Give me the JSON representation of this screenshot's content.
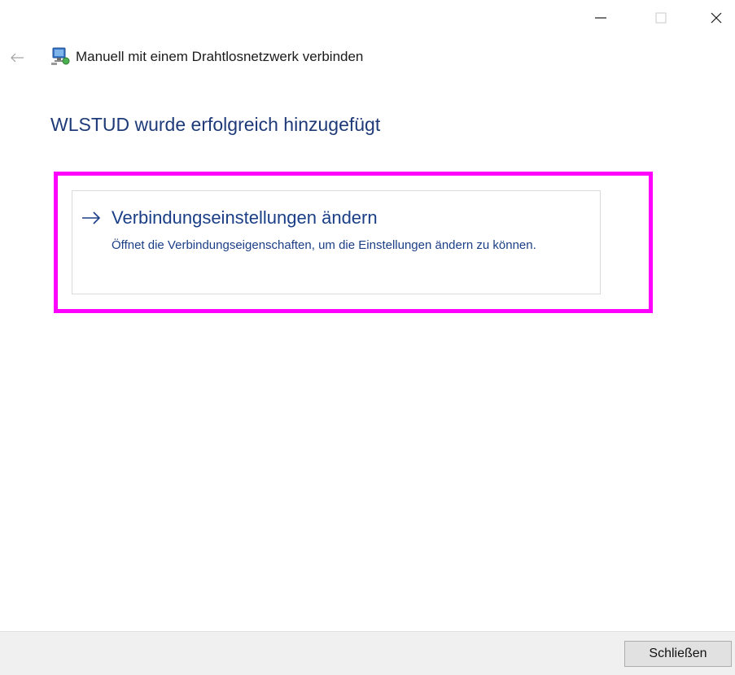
{
  "window": {
    "title": "Manuell mit einem Drahtlosnetzwerk verbinden",
    "caption_icons": [
      "minimize-icon",
      "maximize-icon",
      "close-icon"
    ],
    "back_icon": "arrow-left-icon",
    "app_icon": "network-icon"
  },
  "main": {
    "heading": "WLSTUD wurde erfolgreich hinzugefügt",
    "option": {
      "icon": "arrow-right-icon",
      "title": "Verbindungseinstellungen ändern",
      "description": "Öffnet die Verbindungseigenschaften, um die Einstellungen ändern zu können."
    },
    "highlight_color": "#ff00ff"
  },
  "footer": {
    "close_label": "Schließen"
  },
  "colors": {
    "heading": "#1e3a78",
    "link": "#1b3f86",
    "footer_bg": "#f0f0f0"
  }
}
